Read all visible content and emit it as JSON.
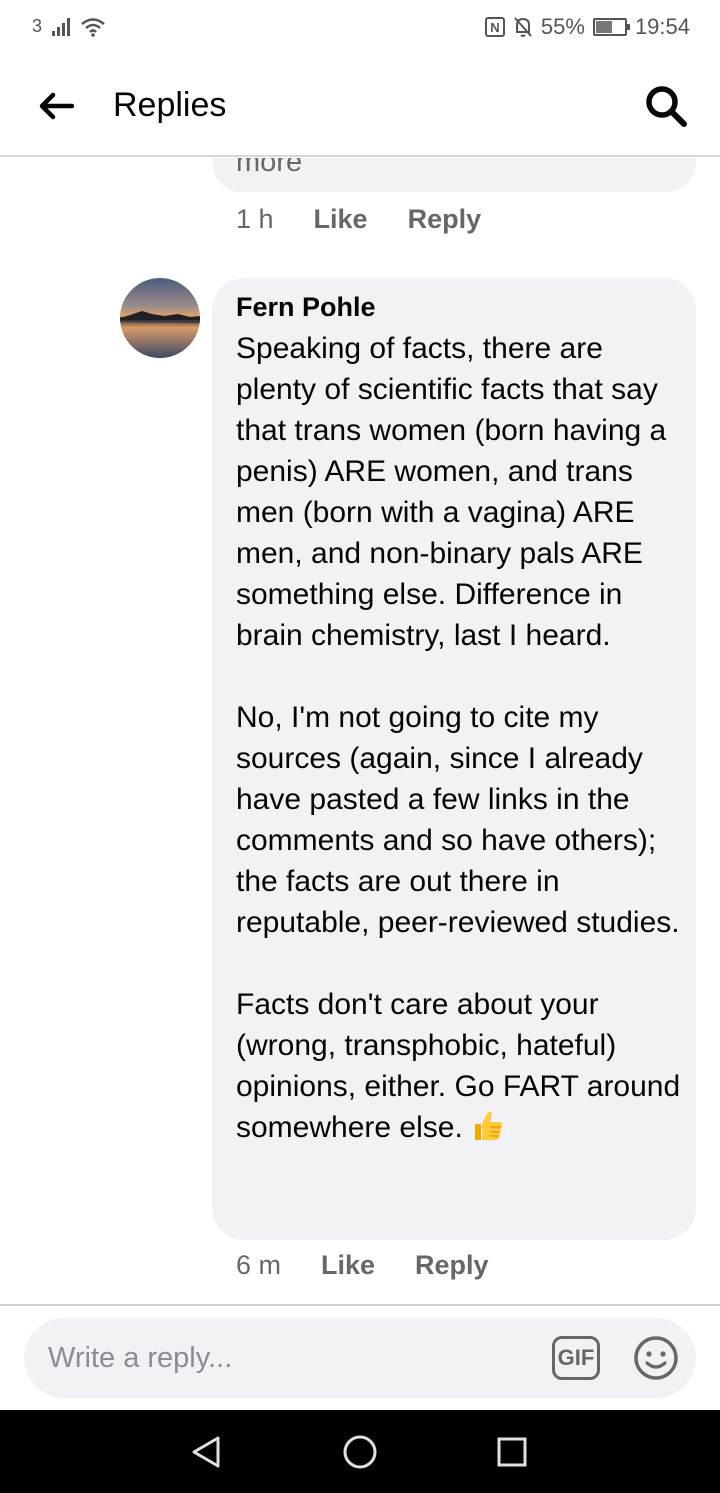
{
  "status_bar": {
    "sim_label": "3",
    "nfc_label": "N",
    "battery_percent": "55%",
    "battery_level": 0.55,
    "time": "19:54"
  },
  "header": {
    "title": "Replies",
    "back_icon": "arrow-left-icon",
    "search_icon": "search-icon"
  },
  "previous_comment": {
    "truncated_text": "more",
    "time": "1 h",
    "like_label": "Like",
    "reply_label": "Reply"
  },
  "comment": {
    "author": "Fern Pohle",
    "paragraphs": [
      "Speaking of facts, there are plenty of scientific facts that say that trans women (born having a penis) ARE women, and trans men (born with a vagina) ARE men, and non-binary pals ARE something else. Difference in brain chemistry, last I heard.",
      "No, I'm not going to cite my sources (again, since I already have pasted a few links in the comments and so have others); the facts are out there in reputable, peer-reviewed studies.",
      "Facts don't care about your (wrong, transphobic, hateful) opinions, either. Go FART around somewhere else."
    ],
    "reaction_emoji": "thumbs-up-icon",
    "time": "6 m",
    "like_label": "Like",
    "reply_label": "Reply"
  },
  "composer": {
    "placeholder": "Write a reply...",
    "gif_label": "GIF",
    "emoji_icon": "smiley-icon"
  },
  "nav": {
    "back_icon": "nav-back-icon",
    "home_icon": "nav-home-icon",
    "recents_icon": "nav-recents-icon"
  },
  "colors": {
    "bubble": "#f0f2f5",
    "secondary_text": "#65676b",
    "primary_text": "#050505"
  }
}
